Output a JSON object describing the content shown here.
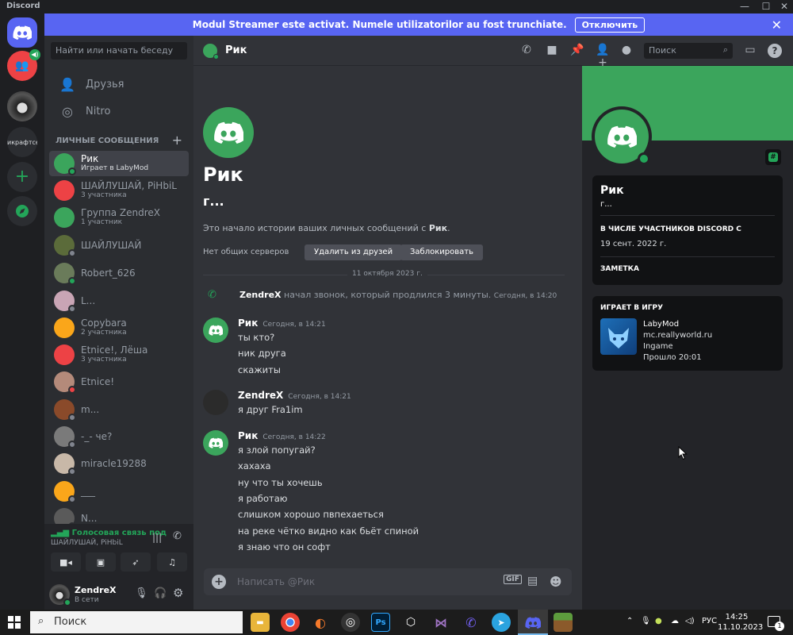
{
  "window": {
    "app_name": "Discord",
    "minimize": "—",
    "maximize": "☐",
    "close": "✕"
  },
  "banner": {
    "text": "Modul Streamer este activat. Numele utilizatorilor au fost trunchiate.",
    "button": "Отключить",
    "close": "✕"
  },
  "guilds": {
    "server_label": "икрафтсерв",
    "add": "+"
  },
  "sidebar": {
    "search_placeholder": "Найти или начать беседу",
    "friends": "Друзья",
    "nitro": "Nitro",
    "dm_header": "ЛИЧНЫЕ СООБЩЕНИЯ",
    "dm_add": "+",
    "dms": [
      {
        "name": "Рик",
        "sub": "Играет в LabyMod",
        "avatar_color": "#3ba55c",
        "status_color": "#23a559"
      },
      {
        "name": "ШАЙЛУШАЙ, PiHbiL",
        "sub": "3 участника",
        "avatar_color": "#ed4245",
        "status_color": ""
      },
      {
        "name": "Группа ZendreX",
        "sub": "1 участник",
        "avatar_color": "#3ba55c",
        "status_color": ""
      },
      {
        "name": "ШАЙЛУШАЙ",
        "sub": "",
        "avatar_color": "#5b6b3a",
        "status_color": "#80848e"
      },
      {
        "name": "Robert_626",
        "sub": "",
        "avatar_color": "#6a7b5a",
        "status_color": "#23a559"
      },
      {
        "name": "L...",
        "sub": "",
        "avatar_color": "#c9a5b5",
        "status_color": "#80848e"
      },
      {
        "name": "Copybara",
        "sub": "2 участника",
        "avatar_color": "#faa61a",
        "status_color": ""
      },
      {
        "name": "Etnice!, Лёша",
        "sub": "3 участника",
        "avatar_color": "#ed4245",
        "status_color": ""
      },
      {
        "name": "Etnice!",
        "sub": "",
        "avatar_color": "#b48a7a",
        "status_color": "#ed4245"
      },
      {
        "name": "m...",
        "sub": "",
        "avatar_color": "#8a4a2a",
        "status_color": "#80848e"
      },
      {
        "name": "-_- че?",
        "sub": "",
        "avatar_color": "#7a7a7a",
        "status_color": "#80848e"
      },
      {
        "name": "miracle19288",
        "sub": "",
        "avatar_color": "#c8b8a8",
        "status_color": "#80848e"
      },
      {
        "name": "___",
        "sub": "",
        "avatar_color": "#faa61a",
        "status_color": "#80848e"
      },
      {
        "name": "N...",
        "sub": "",
        "avatar_color": "#5a5a5a",
        "status_color": "#80848e"
      }
    ]
  },
  "voice": {
    "status": "Голосовая связь под",
    "channel": "ШАЙЛУШАЙ, PiHbiL"
  },
  "user": {
    "name": "ZendreX",
    "status": "В сети"
  },
  "header": {
    "title": "Рик",
    "search_placeholder": "Поиск"
  },
  "intro": {
    "name": "Рик",
    "handle": "г...",
    "text_before": "Это начало истории ваших личных сообщений с",
    "text_name": "Рик",
    "text_after": ".",
    "mutual": "Нет общих серверов",
    "remove_friend": "Удалить из друзей",
    "block": "Заблокировать",
    "date_divider": "11 октября 2023 г."
  },
  "system_message": {
    "author": "ZendreX",
    "text": "начал звонок, который продлился 3 минуты.",
    "timestamp": "Сегодня, в 14:20"
  },
  "messages": [
    {
      "author": "Рик",
      "timestamp": "Сегодня, в 14:21",
      "avatar_color": "#3ba55c",
      "lines": [
        "ты кто?",
        "ник друга",
        "скажиты"
      ]
    },
    {
      "author": "ZendreX",
      "timestamp": "Сегодня, в 14:21",
      "avatar_color": "#2b2b2b",
      "lines": [
        "я друг Fra1im"
      ]
    },
    {
      "author": "Рик",
      "timestamp": "Сегодня, в 14:22",
      "avatar_color": "#3ba55c",
      "lines": [
        "я злой попугай?",
        "хахаха",
        "ну что ты хочешь",
        "я работаю",
        "слишком хорошо пвпехаеться",
        "на реке чётко видно как бьёт спиной",
        "я знаю что он софт"
      ]
    }
  ],
  "composer": {
    "placeholder": "Написать @Рик",
    "gif": "GIF"
  },
  "profile": {
    "name": "Рик",
    "handle": "г...",
    "member_since_label": "В ЧИСЛЕ УЧАСТНИКОВ DISCORD С",
    "member_since": "19 сент. 2022 г.",
    "note_label": "ЗАМЕТКА",
    "activity_label": "ИГРАЕТ В ИГРУ",
    "game": "LabyMod",
    "server": "mc.reallyworld.ru",
    "state": "Ingame",
    "elapsed": "Прошло 20:01",
    "accent": "#3ba55c"
  },
  "taskbar": {
    "search": "Поиск",
    "lang": "РУС",
    "time": "14:25",
    "date": "11.10.2023",
    "notif": "1"
  }
}
